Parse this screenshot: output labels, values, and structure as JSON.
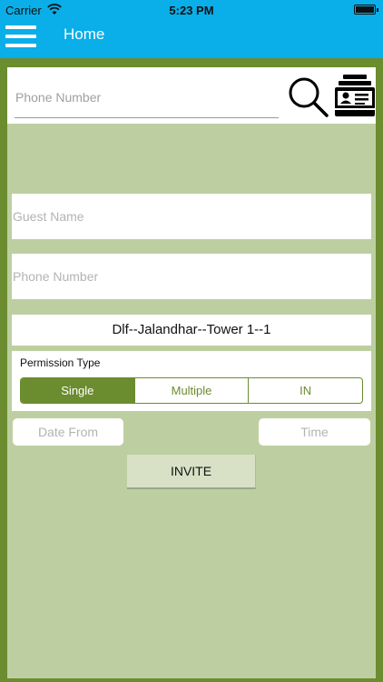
{
  "status_bar": {
    "carrier": "Carrier",
    "time": "5:23 PM",
    "wifi_icon": "wifi-icon",
    "battery_icon": "battery-icon"
  },
  "nav": {
    "title": "Home",
    "menu_icon": "hamburger-menu-icon"
  },
  "search": {
    "phone_placeholder": "Phone Number",
    "phone_value": "",
    "search_icon": "magnifier-icon",
    "contacts_icon": "contact-card-icon"
  },
  "form": {
    "guest_name_placeholder": "Guest Name",
    "guest_name_value": "",
    "phone_placeholder": "Phone Number",
    "phone_value": "",
    "tower": "Dlf--Jalandhar--Tower 1--1",
    "permission_label": "Permission Type",
    "permission_options": [
      "Single",
      "Multiple",
      "IN"
    ],
    "permission_selected": "Single",
    "date_from": "Date From",
    "time": "Time",
    "invite_label": "INVITE"
  },
  "colors": {
    "nav_blue": "#0aaee8",
    "frame_green": "#6b8c2f",
    "panel_green": "#bdcfa1",
    "button_light": "#d8e1c6"
  }
}
